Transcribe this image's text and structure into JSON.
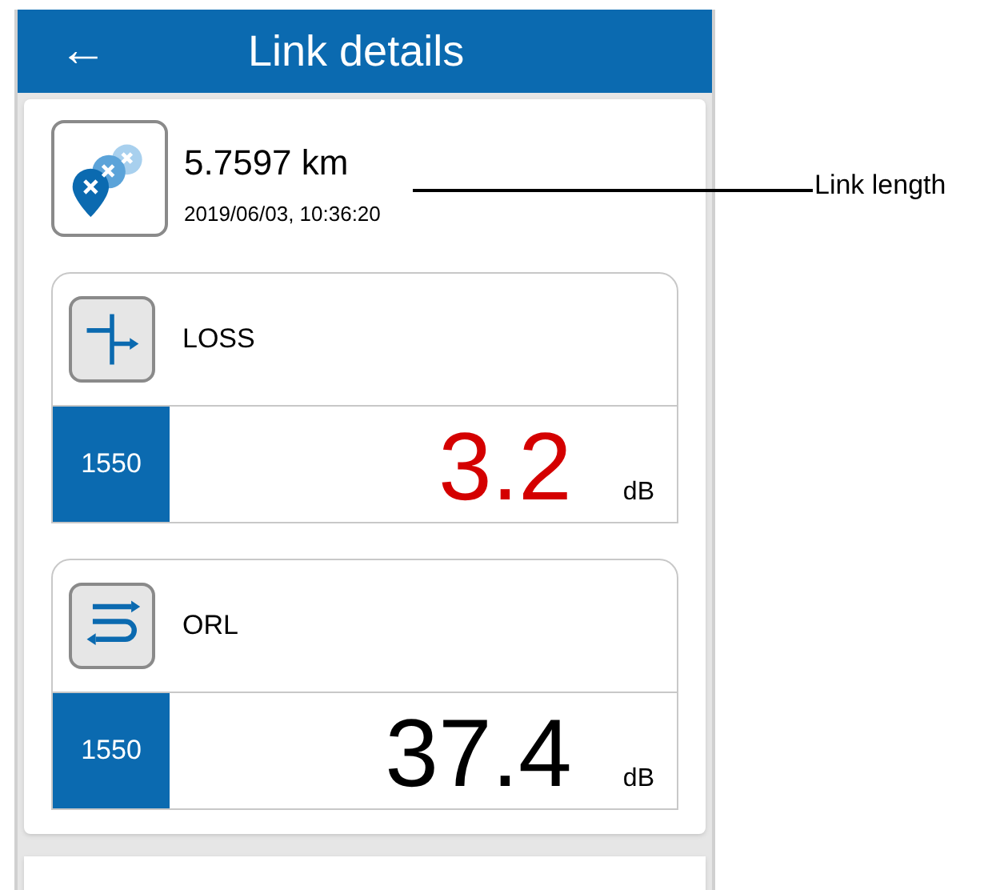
{
  "header": {
    "back_icon": "←",
    "title": "Link details"
  },
  "link": {
    "length": "5.7597 km",
    "timestamp": "2019/06/03, 10:36:20"
  },
  "measurements": [
    {
      "kind": "loss",
      "name": "LOSS",
      "wavelength": "1550",
      "value": "3.2",
      "unit": "dB",
      "color": "#d40000"
    },
    {
      "kind": "orl",
      "name": "ORL",
      "wavelength": "1550",
      "value": "37.4",
      "unit": "dB",
      "color": "#000000"
    }
  ],
  "callout": {
    "label": "Link length"
  }
}
